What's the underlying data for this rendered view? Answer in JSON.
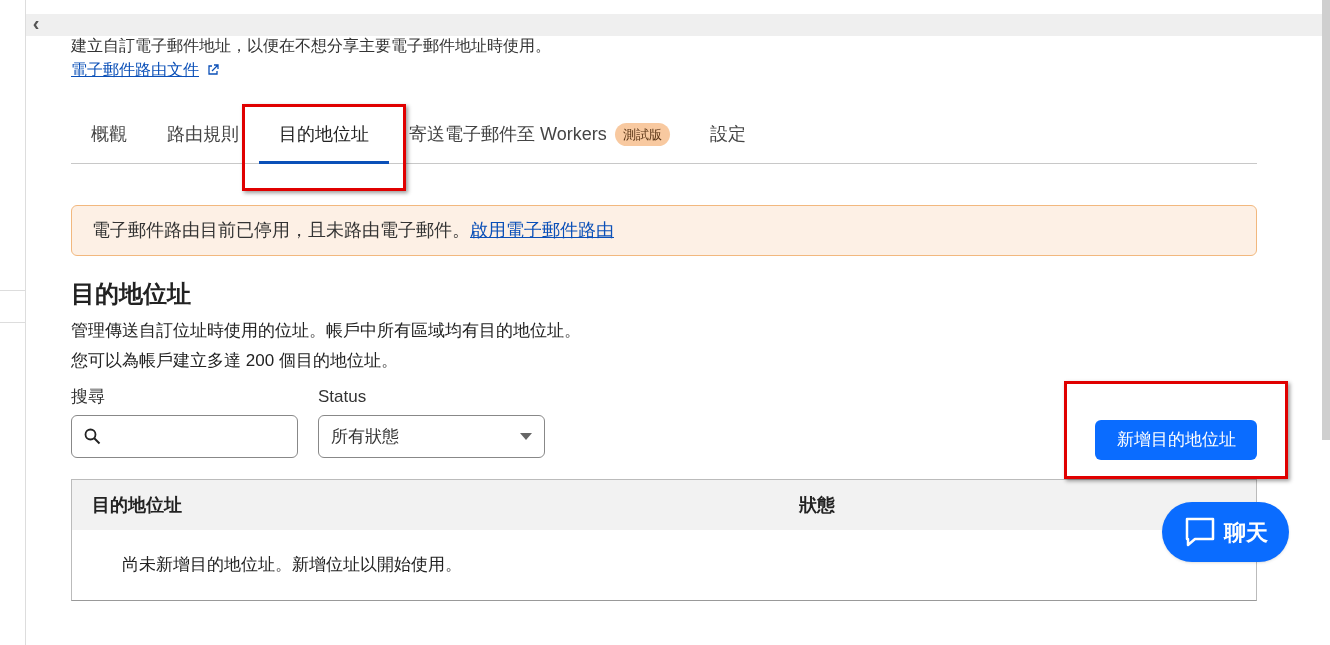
{
  "top_bar": {
    "back_icon": "‹"
  },
  "intro": {
    "text": "建立自訂電子郵件地址，以便在不想分享主要電子郵件地址時使用。",
    "doc_link": "電子郵件路由文件"
  },
  "tabs": [
    {
      "label": "概觀",
      "selected": false,
      "highlighted": false
    },
    {
      "label": "路由規則",
      "selected": false,
      "highlighted": false
    },
    {
      "label": "目的地位址",
      "selected": true,
      "highlighted": true
    },
    {
      "label": "寄送電子郵件至 Workers",
      "badge": "測試版",
      "selected": false,
      "highlighted": false
    },
    {
      "label": "設定",
      "selected": false,
      "highlighted": false
    }
  ],
  "banner": {
    "text": "電子郵件路由目前已停用，且未路由電子郵件。",
    "link": "啟用電子郵件路由"
  },
  "section": {
    "title": "目的地位址",
    "description": [
      "管理傳送自訂位址時使用的位址。帳戶中所有區域均有目的地位址。",
      "您可以為帳戶建立多達 200 個目的地位址。"
    ]
  },
  "filters": {
    "search": {
      "label": "搜尋"
    },
    "status": {
      "label": "Status",
      "value": "所有狀態"
    }
  },
  "add_button": {
    "label": "新增目的地位址",
    "highlighted": true
  },
  "table": {
    "columns": [
      "目的地位址",
      "狀態"
    ],
    "empty_message": "尚未新增目的地位址。新增位址以開始使用。"
  },
  "chat_button": {
    "label": "聊天"
  }
}
